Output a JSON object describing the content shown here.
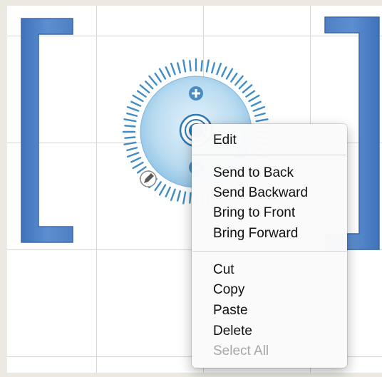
{
  "colors": {
    "bracket": "#4f80c3",
    "dial_ring": "#3f8cc7",
    "menu_text": "#111111",
    "menu_disabled": "#a7a7a7"
  },
  "icons": {
    "zoom_in": "plus-icon",
    "zoom_out": "minus-icon",
    "center": "target-icon",
    "edit": "pencil-icon"
  },
  "context_menu": {
    "edit": "Edit",
    "send_to_back": "Send to Back",
    "send_backward": "Send Backward",
    "bring_to_front": "Bring to Front",
    "bring_forward": "Bring Forward",
    "cut": "Cut",
    "copy": "Copy",
    "paste": "Paste",
    "delete": "Delete",
    "select_all": "Select All"
  }
}
